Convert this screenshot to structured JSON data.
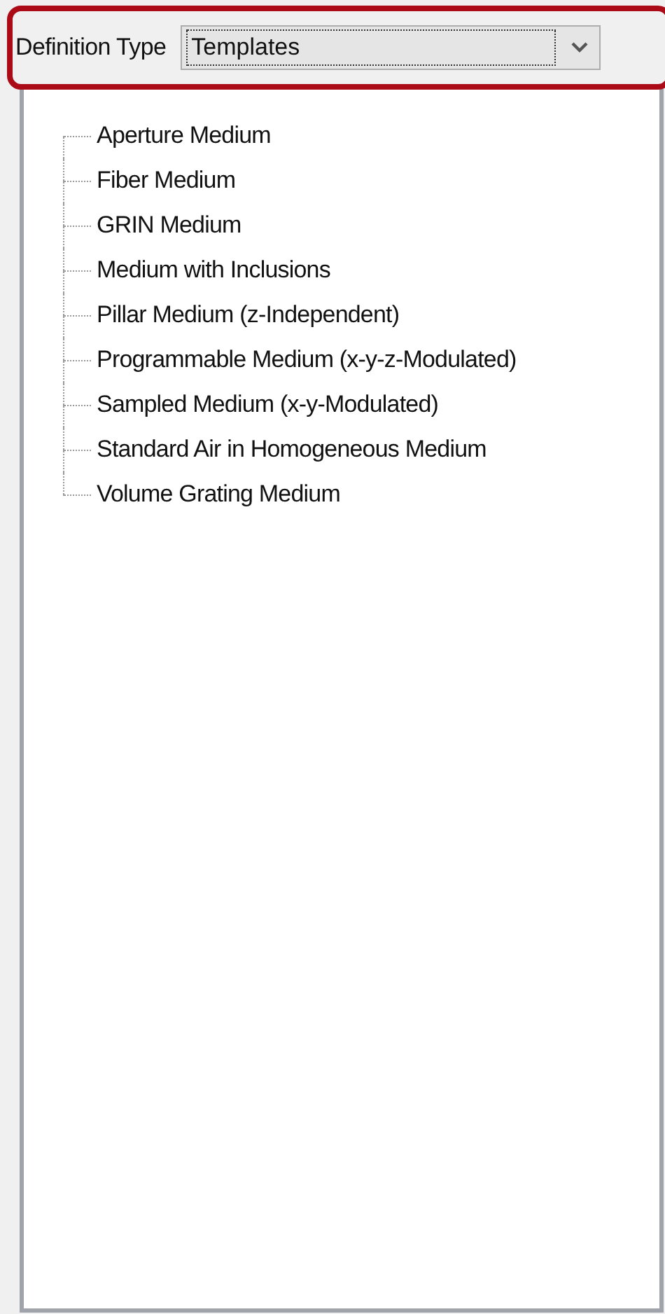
{
  "definition_type": {
    "label": "Definition Type",
    "value": "Templates"
  },
  "tree": {
    "items": [
      {
        "label": "Aperture Medium"
      },
      {
        "label": "Fiber Medium"
      },
      {
        "label": "GRIN Medium"
      },
      {
        "label": "Medium with Inclusions"
      },
      {
        "label": "Pillar Medium (z-Independent)"
      },
      {
        "label": "Programmable Medium (x-y-z-Modulated)"
      },
      {
        "label": "Sampled Medium (x-y-Modulated)"
      },
      {
        "label": "Standard Air in Homogeneous Medium"
      },
      {
        "label": "Volume Grating Medium"
      }
    ]
  }
}
